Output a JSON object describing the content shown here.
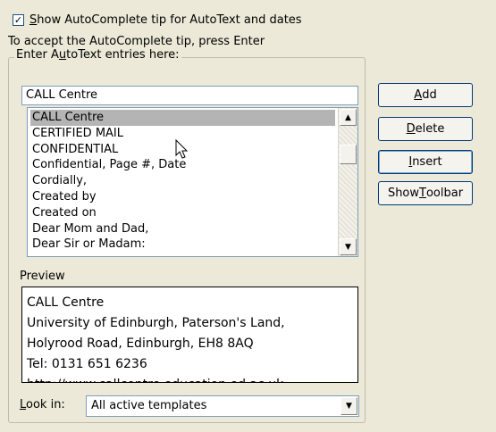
{
  "autocomplete": {
    "checkbox_checked": true,
    "checkbox_mark": "✓",
    "checkbox_label_access": "S",
    "checkbox_label_rest": "how AutoComplete tip for AutoText and dates",
    "hint": "To accept the AutoComplete tip, press Enter"
  },
  "entries": {
    "group_label_pre": "Enter A",
    "group_label_access": "u",
    "group_label_post": "toText entries here:",
    "input_value": "CALL Centre",
    "items": [
      "CALL Centre",
      "CERTIFIED MAIL",
      "CONFIDENTIAL",
      "Confidential, Page #, Date",
      "Cordially,",
      "Created by",
      "Created on",
      "Dear Mom and Dad,",
      "Dear Sir or Madam:"
    ],
    "selected_index": 0
  },
  "buttons": {
    "add": {
      "access": "A",
      "rest": "dd"
    },
    "delete": {
      "access": "D",
      "rest": "elete"
    },
    "insert": {
      "access": "I",
      "rest": "nsert"
    },
    "show_toolbar": {
      "pre": "Show ",
      "access": "T",
      "rest": "oolbar"
    }
  },
  "preview": {
    "label": "Preview",
    "lines": [
      "CALL Centre",
      "University of Edinburgh, Paterson's Land,",
      "Holyrood Road, Edinburgh, EH8 8AQ",
      "Tel: 0131 651 6236",
      "http://www.callcentre.education.ed.ac.uk"
    ]
  },
  "lookin": {
    "label_access": "L",
    "label_rest": "ook in:",
    "value": "All active templates"
  },
  "icons": {
    "scroll_up": "▲",
    "scroll_down": "▼",
    "dropdown": "▼"
  },
  "colors": {
    "dialog_bg": "#ece9d8",
    "selection": "#b4b4b4",
    "button_border": "#003c74"
  }
}
